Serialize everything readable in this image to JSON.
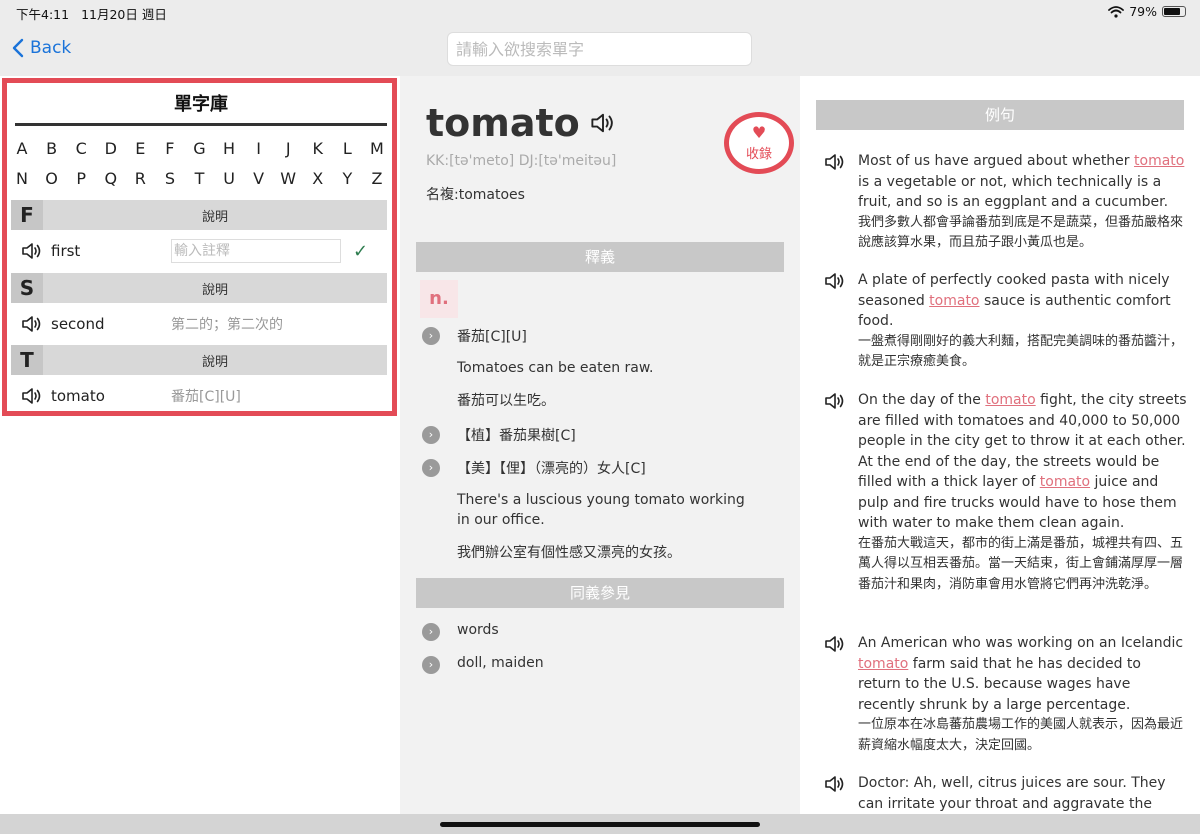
{
  "status": {
    "time": "下午4:11",
    "date": "11月20日 週日",
    "battery": "79%",
    "battery_level": 0.79
  },
  "nav": {
    "back_label": "Back",
    "search_placeholder": "請輸入欲搜索單字"
  },
  "wordbank": {
    "title": "單字庫",
    "alpha_row1": [
      "A",
      "B",
      "C",
      "D",
      "E",
      "F",
      "G",
      "H",
      "I",
      "J",
      "K",
      "L",
      "M"
    ],
    "alpha_row2": [
      "N",
      "O",
      "P",
      "Q",
      "R",
      "S",
      "T",
      "U",
      "V",
      "W",
      "X",
      "Y",
      "Z"
    ],
    "sections": [
      {
        "letter": "F",
        "label": "說明",
        "word": "first",
        "definition": "",
        "note_placeholder": "輸入註釋"
      },
      {
        "letter": "S",
        "label": "說明",
        "word": "second",
        "definition": "第二的；第二次的"
      },
      {
        "letter": "T",
        "label": "說明",
        "word": "tomato",
        "definition": "番茄[C][U]"
      }
    ]
  },
  "entry": {
    "word": "tomato",
    "phonetic": "KK:[tə'meto] DJ:[tə'meitəu]",
    "plural": "名複:tomatoes",
    "favorite_label": "收錄",
    "definition_header": "釋義",
    "pos": "n.",
    "definitions": [
      {
        "text": "番茄[C][U]",
        "example_en": "Tomatoes can be eaten raw.",
        "example_zh": "番茄可以生吃。"
      },
      {
        "text": "【植】番茄果樹[C]"
      },
      {
        "text": "【美】【俚】（漂亮的）女人[C]",
        "example_en": "There's a luscious young tomato working in our office.",
        "example_zh": "我們辦公室有個性感又漂亮的女孩。"
      }
    ],
    "synonym_header": "同義參見",
    "synonyms": [
      "words",
      "doll, maiden"
    ]
  },
  "examples": {
    "header": "例句",
    "items": [
      {
        "en_before": "Most of us have argued about whether ",
        "highlight": "tomato",
        "en_after": " is a vegetable or not, which technically is a fruit, and so is an eggplant and a cucumber.",
        "zh": "我們多數人都會爭論番茄到底是不是蔬菜，但番茄嚴格來說應該算水果，而且茄子跟小黃瓜也是。"
      },
      {
        "en_before": "A plate of perfectly cooked pasta with nicely seasoned ",
        "highlight": "tomato",
        "en_after": " sauce is authentic comfort food.",
        "zh": "一盤煮得剛剛好的義大利麵，搭配完美調味的番茄醬汁，就是正宗療癒美食。"
      },
      {
        "en_before": "On the day of the ",
        "highlight": "tomato",
        "en_mid": " fight, the city streets are filled with tomatoes and 40,000 to 50,000 people in the city get to throw it at each other. At the end of the day, the streets would be filled with a thick layer of ",
        "highlight2": "tomato",
        "en_after": " juice and pulp and fire trucks would have to hose them with water to make them clean again.",
        "zh": "在番茄大戰這天，都市的街上滿是番茄，城裡共有四、五萬人得以互相丟番茄。當一天結束，街上會鋪滿厚厚一層番茄汁和果肉，消防車會用水管將它們再沖洗乾淨。"
      },
      {
        "en_before": "An American who was working on an Icelandic ",
        "highlight": "tomato",
        "en_after": " farm said that he has decided to return to the U.S. because wages have recently shrunk by a large percentage.",
        "zh": "一位原本在冰島蕃茄農場工作的美國人就表示，因為最近薪資縮水幅度太大，決定回國。"
      },
      {
        "en_before": "Doctor: Ah, well, citrus juices are sour. They can irritate your throat and aggravate the condition.",
        "highlight": "",
        "en_after": "",
        "zh": ""
      }
    ]
  },
  "colors": {
    "accent": "#e34b56",
    "highlight": "#e0707d",
    "link": "#1a73d9",
    "band": "#c8c8c8"
  }
}
